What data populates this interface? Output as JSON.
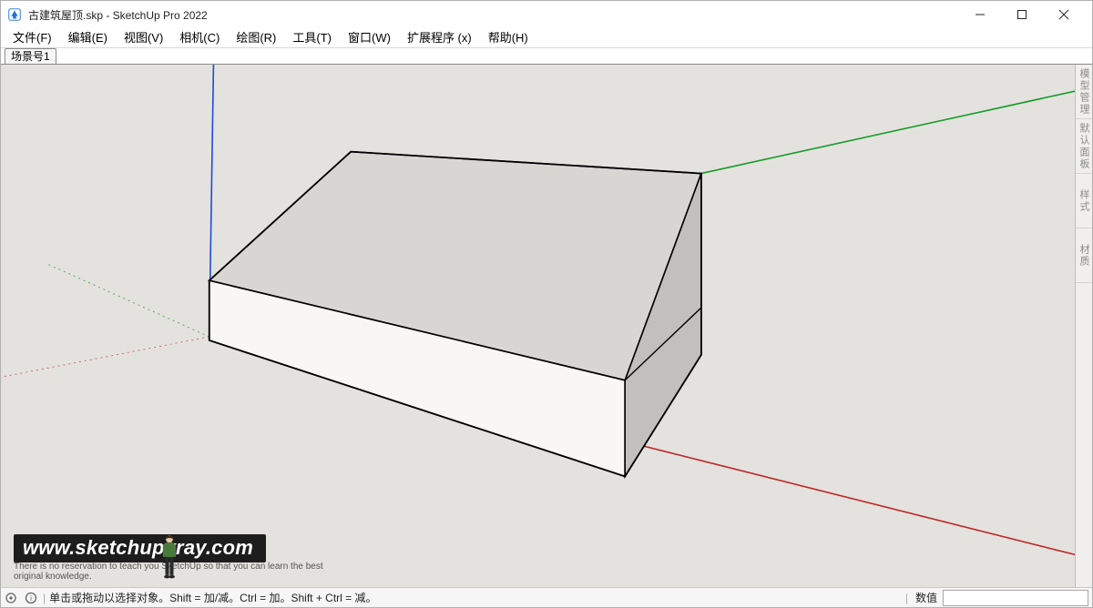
{
  "title": "古建筑屋顶.skp - SketchUp Pro 2022",
  "menus": [
    "文件(F)",
    "编辑(E)",
    "视图(V)",
    "相机(C)",
    "绘图(R)",
    "工具(T)",
    "窗口(W)",
    "扩展程序 (x)",
    "帮助(H)"
  ],
  "scene_tab": "场景号1",
  "right_tabs": [
    "模型管理",
    "默认面板",
    "样式",
    "材质"
  ],
  "status_hint": "单击或拖动以选择对象。Shift = 加/减。Ctrl = 加。Shift + Ctrl = 减。",
  "vcb_label": "数值",
  "watermark_url": "www.sketchupvray.com",
  "watermark_sub": "There is no reservation to teach you SketchUp so that you can learn the best original knowledge."
}
